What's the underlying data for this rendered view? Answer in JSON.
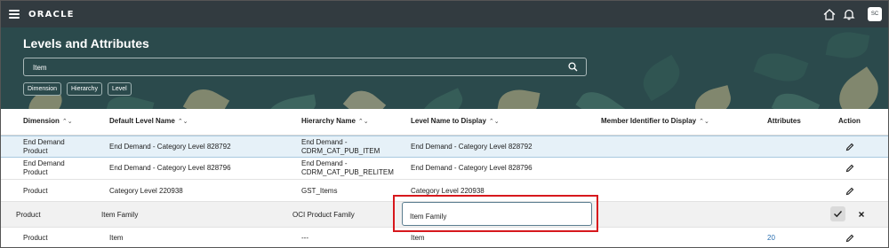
{
  "app": {
    "brand": "ORACLE",
    "user_initials": "SC"
  },
  "page": {
    "title": "Levels and Attributes"
  },
  "search": {
    "value": "Item"
  },
  "filters": [
    "Dimension",
    "Hierarchy",
    "Level"
  ],
  "table": {
    "columns": [
      "Dimension",
      "Default Level Name",
      "Hierarchy Name",
      "Level Name to Display",
      "Member Identifier to Display",
      "Attributes",
      "Action"
    ],
    "rows": [
      {
        "dimension": [
          "End Demand",
          "Product"
        ],
        "default_level": "End Demand - Category Level 828792",
        "hierarchy": [
          "End Demand -",
          "CDRM_CAT_PUB_ITEM"
        ],
        "level_display": "End Demand - Category Level 828792",
        "attributes": ""
      },
      {
        "dimension": [
          "End Demand",
          "Product"
        ],
        "default_level": "End Demand - Category Level 828796",
        "hierarchy": [
          "End Demand -",
          "CDRM_CAT_PUB_RELITEM"
        ],
        "level_display": "End Demand - Category Level 828796",
        "attributes": ""
      },
      {
        "dimension": [
          "Product"
        ],
        "default_level": "Category Level 220938",
        "hierarchy": [
          "GST_Items"
        ],
        "level_display": "Category Level 220938",
        "attributes": ""
      },
      {
        "dimension": [
          "Product"
        ],
        "default_level": "Item Family",
        "hierarchy": [
          "OCI Product Family"
        ],
        "level_display": "Item Family",
        "attributes": ""
      },
      {
        "dimension": [
          "Product"
        ],
        "default_level": "Item",
        "hierarchy": [
          "---"
        ],
        "level_display": "Item",
        "attributes": "20"
      }
    ]
  },
  "colors": {
    "topbar": "#323b40",
    "header": "#2b4a4c",
    "selected_row": "#e6f1f8",
    "edit_row": "#f1f1f1",
    "highlight": "#d7181d",
    "link": "#2a6fb0"
  },
  "icons": [
    "hamburger-icon",
    "home-icon",
    "bell-icon",
    "search-icon",
    "sort-icon",
    "pencil-icon",
    "check-icon",
    "close-icon"
  ]
}
